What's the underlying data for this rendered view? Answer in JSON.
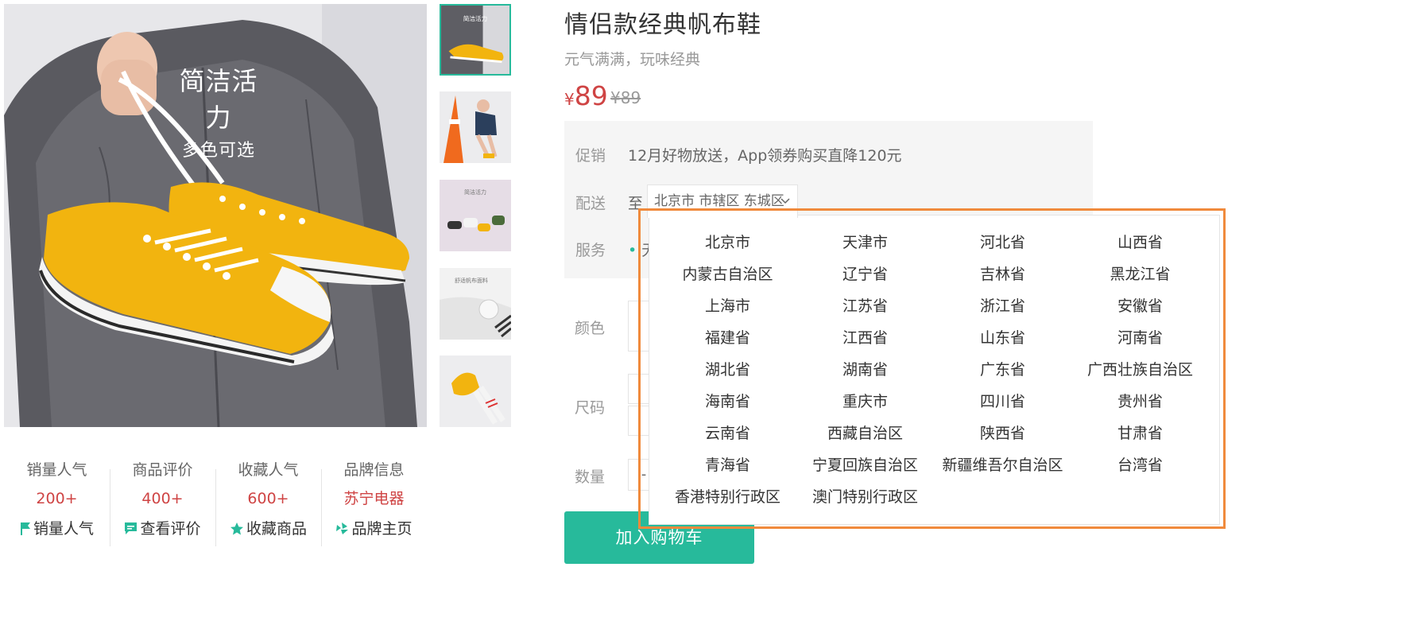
{
  "main_image": {
    "caption_line1": "简洁活力",
    "caption_line2": "多色可选"
  },
  "thumbnails": [
    {
      "name": "thumb-shoe-hanging",
      "active": true,
      "caption": "简洁活力"
    },
    {
      "name": "thumb-model-cone",
      "active": false
    },
    {
      "name": "thumb-shoes-pink",
      "active": false,
      "caption": "简洁活力"
    },
    {
      "name": "thumb-canvas-detail",
      "active": false,
      "caption": "舒适帆布面料"
    },
    {
      "name": "thumb-socks-legs",
      "active": false
    }
  ],
  "stats": [
    {
      "label": "销量人气",
      "value": "200+",
      "link": "销量人气",
      "icon": "flag-icon"
    },
    {
      "label": "商品评价",
      "value": "400+",
      "link": "查看评价",
      "icon": "comment-icon"
    },
    {
      "label": "收藏人气",
      "value": "600+",
      "link": "收藏商品",
      "icon": "star-icon"
    },
    {
      "label": "品牌信息",
      "value": "苏宁电器",
      "link": "品牌主页",
      "icon": "brand-icon"
    }
  ],
  "product": {
    "title": "情侣款经典帆布鞋",
    "subtitle": "元气满满，玩味经典",
    "currency": "¥",
    "price": "89",
    "old_price": "¥89"
  },
  "info": {
    "promo_label": "促销",
    "promo_text": "12月好物放送，App领券购买直降120元",
    "delivery_label": "配送",
    "delivery_prefix": "至",
    "delivery_region": "北京市 市辖区 东城区",
    "service_label": "服务",
    "service_partial": "无"
  },
  "options": {
    "color_label": "颜色",
    "size_label": "尺码",
    "quantity_label": "数量",
    "quantity_minus": "-"
  },
  "cart_button": "加入购物车",
  "region_dropdown": {
    "items": [
      "北京市",
      "天津市",
      "河北省",
      "山西省",
      "内蒙古自治区",
      "辽宁省",
      "吉林省",
      "黑龙江省",
      "上海市",
      "江苏省",
      "浙江省",
      "安徽省",
      "福建省",
      "江西省",
      "山东省",
      "河南省",
      "湖北省",
      "湖南省",
      "广东省",
      "广西壮族自治区",
      "海南省",
      "重庆市",
      "四川省",
      "贵州省",
      "云南省",
      "西藏自治区",
      "陕西省",
      "甘肃省",
      "青海省",
      "宁夏回族自治区",
      "新疆维吾尔自治区",
      "台湾省",
      "香港特别行政区",
      "澳门特别行政区"
    ]
  },
  "colors": {
    "accent": "#27ba9b",
    "price": "#cf4444",
    "highlight": "#f08a3c",
    "shoe": "#f2b40f"
  }
}
